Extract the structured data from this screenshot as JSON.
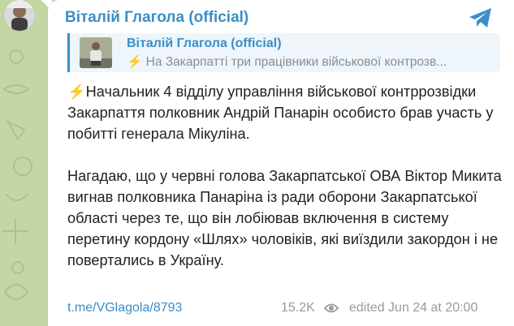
{
  "channel": {
    "name": "Віталій Глагола (official)"
  },
  "reply": {
    "author": "Віталій Глагола (official)",
    "emoji": "⚡",
    "preview": "На Закарпатті три працівники військової контрозв..."
  },
  "message": {
    "emoji": "⚡",
    "paragraph1": "Начальник 4 відділу управління військової контррозвідки Закарпаття полковник Андрій Панарін особисто брав участь у побитті генерала Мікуліна.",
    "paragraph2": "Нагадаю, що у червні голова Закарпатської ОВА Віктор Микита вигнав полковника Панаріна із ради оборони Закарпатської області через те, що він лобіював включення в систему перетину кордону «Шлях» чоловіків, які виїздили закордон і не повертались в Україну."
  },
  "footer": {
    "link": "t.me/VGlagola/8793",
    "views": "15.2K",
    "edited": "edited  Jun 24 at 20:00"
  },
  "colors": {
    "accent": "#3a8fc8",
    "background": "#c4d6a4",
    "bubble": "#ffffff",
    "meta": "#9a9a9a"
  },
  "icons": {
    "share": "telegram-share-icon",
    "views": "eye-icon"
  }
}
